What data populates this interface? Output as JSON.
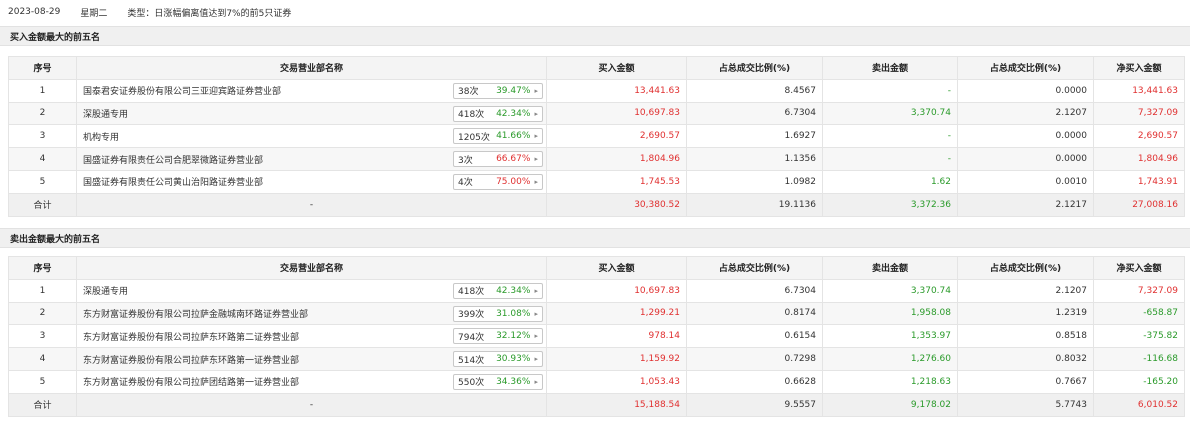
{
  "header": {
    "date": "2023-08-29",
    "weekday": "星期二",
    "type_text": "类型：日涨幅偏离值达到7%的前5只证券"
  },
  "columns": [
    "序号",
    "交易营业部名称",
    "买入金额",
    "占总成交比例(%)",
    "卖出金额",
    "占总成交比例(%)",
    "净买入金额"
  ],
  "buy_section": {
    "title": "买入金额最大的前五名",
    "rows": [
      {
        "idx": "1",
        "name": "国泰君安证券股份有限公司三亚迎宾路证券营业部",
        "times": "38次",
        "pct": "39.47%",
        "pct_color": "green",
        "buy": "13,441.63",
        "buy_ratio": "8.4567",
        "sell": "-",
        "sell_ratio": "0.0000",
        "net": "13,441.63",
        "net_color": "red"
      },
      {
        "idx": "2",
        "name": "深股通专用",
        "times": "418次",
        "pct": "42.34%",
        "pct_color": "green",
        "buy": "10,697.83",
        "buy_ratio": "6.7304",
        "sell": "3,370.74",
        "sell_ratio": "2.1207",
        "net": "7,327.09",
        "net_color": "red"
      },
      {
        "idx": "3",
        "name": "机构专用",
        "times": "1205次",
        "pct": "41.66%",
        "pct_color": "green",
        "buy": "2,690.57",
        "buy_ratio": "1.6927",
        "sell": "-",
        "sell_ratio": "0.0000",
        "net": "2,690.57",
        "net_color": "red"
      },
      {
        "idx": "4",
        "name": "国盛证券有限责任公司合肥翠微路证券营业部",
        "times": "3次",
        "pct": "66.67%",
        "pct_color": "red",
        "buy": "1,804.96",
        "buy_ratio": "1.1356",
        "sell": "-",
        "sell_ratio": "0.0000",
        "net": "1,804.96",
        "net_color": "red"
      },
      {
        "idx": "5",
        "name": "国盛证券有限责任公司黄山治阳路证券营业部",
        "times": "4次",
        "pct": "75.00%",
        "pct_color": "red",
        "buy": "1,745.53",
        "buy_ratio": "1.0982",
        "sell": "1.62",
        "sell_ratio": "0.0010",
        "net": "1,743.91",
        "net_color": "red"
      }
    ],
    "total": {
      "label": "合计",
      "name": "-",
      "buy": "30,380.52",
      "buy_ratio": "19.1136",
      "sell": "3,372.36",
      "sell_ratio": "2.1217",
      "net": "27,008.16",
      "net_color": "red"
    }
  },
  "sell_section": {
    "title": "卖出金额最大的前五名",
    "rows": [
      {
        "idx": "1",
        "name": "深股通专用",
        "times": "418次",
        "pct": "42.34%",
        "pct_color": "green",
        "buy": "10,697.83",
        "buy_ratio": "6.7304",
        "sell": "3,370.74",
        "sell_ratio": "2.1207",
        "net": "7,327.09",
        "net_color": "red"
      },
      {
        "idx": "2",
        "name": "东方财富证券股份有限公司拉萨金融城南环路证券营业部",
        "times": "399次",
        "pct": "31.08%",
        "pct_color": "green",
        "buy": "1,299.21",
        "buy_ratio": "0.8174",
        "sell": "1,958.08",
        "sell_ratio": "1.2319",
        "net": "-658.87",
        "net_color": "green"
      },
      {
        "idx": "3",
        "name": "东方财富证券股份有限公司拉萨东环路第二证券营业部",
        "times": "794次",
        "pct": "32.12%",
        "pct_color": "green",
        "buy": "978.14",
        "buy_ratio": "0.6154",
        "sell": "1,353.97",
        "sell_ratio": "0.8518",
        "net": "-375.82",
        "net_color": "green"
      },
      {
        "idx": "4",
        "name": "东方财富证券股份有限公司拉萨东环路第一证券营业部",
        "times": "514次",
        "pct": "30.93%",
        "pct_color": "green",
        "buy": "1,159.92",
        "buy_ratio": "0.7298",
        "sell": "1,276.60",
        "sell_ratio": "0.8032",
        "net": "-116.68",
        "net_color": "green"
      },
      {
        "idx": "5",
        "name": "东方财富证券股份有限公司拉萨团结路第一证券营业部",
        "times": "550次",
        "pct": "34.36%",
        "pct_color": "green",
        "buy": "1,053.43",
        "buy_ratio": "0.6628",
        "sell": "1,218.63",
        "sell_ratio": "0.7667",
        "net": "-165.20",
        "net_color": "green"
      }
    ],
    "total": {
      "label": "合计",
      "name": "-",
      "buy": "15,188.54",
      "buy_ratio": "9.5557",
      "sell": "9,178.02",
      "sell_ratio": "5.7743",
      "net": "6,010.52",
      "net_color": "red"
    }
  },
  "colors": {
    "red": "#e03030",
    "green": "#2a9a2a"
  }
}
